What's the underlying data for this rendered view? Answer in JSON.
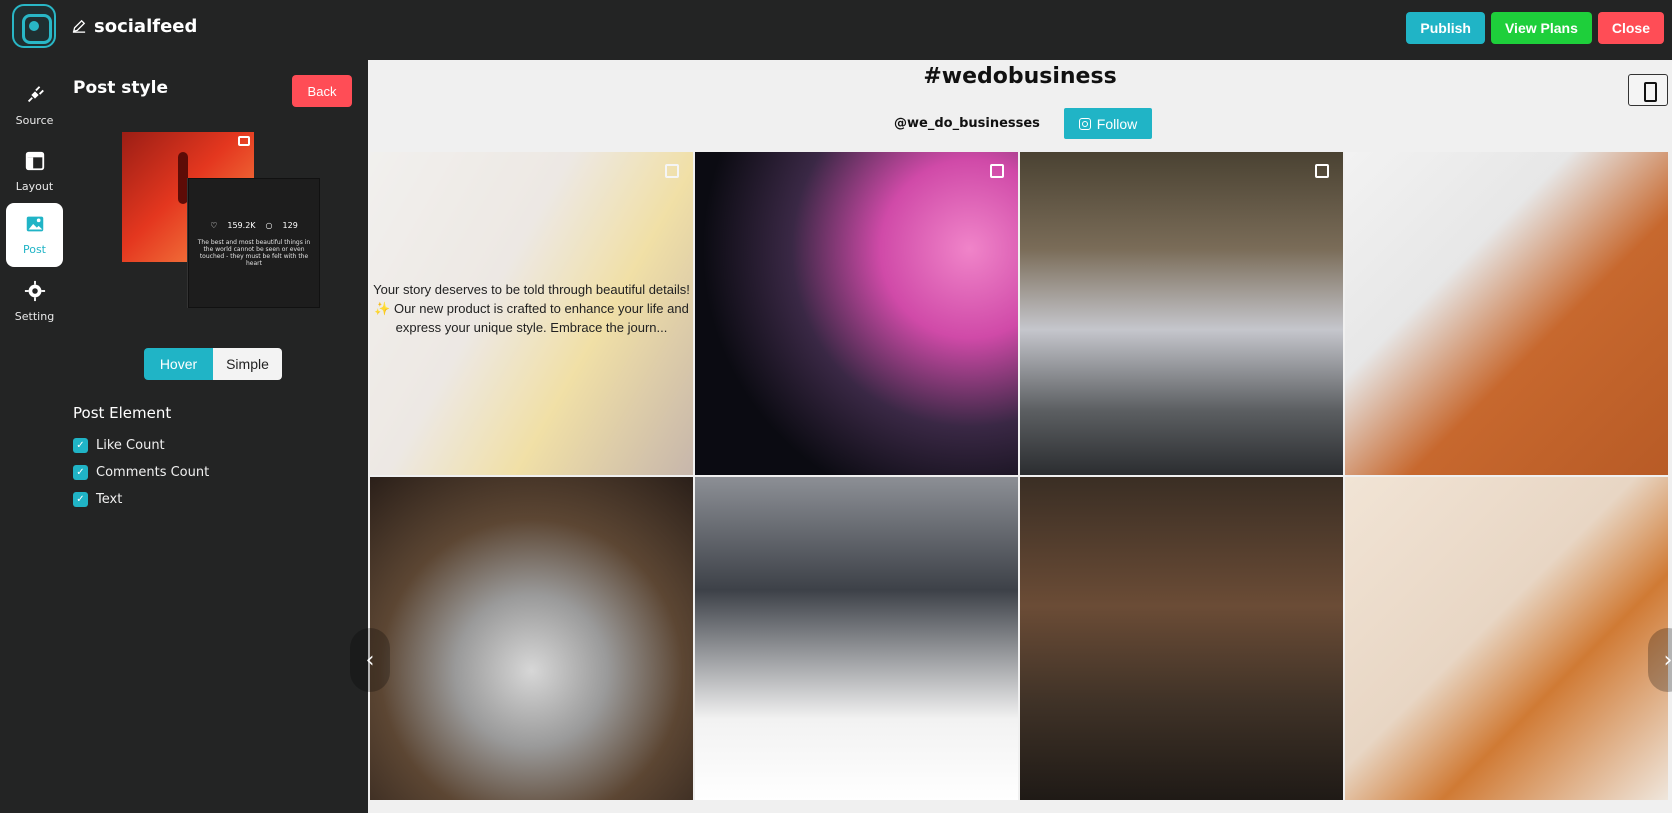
{
  "app": {
    "title": "socialfeed"
  },
  "toolbar": {
    "publish_label": "Publish",
    "view_plans_label": "View Plans",
    "close_label": "Close"
  },
  "leftnav": {
    "items": [
      {
        "label": "Source",
        "icon": "plug-icon"
      },
      {
        "label": "Layout",
        "icon": "layout-icon"
      },
      {
        "label": "Post",
        "icon": "image-icon",
        "active": true
      },
      {
        "label": "Setting",
        "icon": "gear-icon"
      }
    ]
  },
  "panel": {
    "title": "Post style",
    "back_label": "Back",
    "preview": {
      "likes": "159.2K",
      "comments": "129",
      "text": "The best and most beautiful things in the world cannot be seen or even touched - they must be felt with the heart"
    },
    "toggle": {
      "hover_label": "Hover",
      "simple_label": "Simple",
      "selected": "Hover"
    },
    "post_element_title": "Post Element",
    "elements": [
      {
        "label": "Like Count",
        "checked": true
      },
      {
        "label": "Comments Count",
        "checked": true
      },
      {
        "label": "Text",
        "checked": true
      }
    ]
  },
  "feed": {
    "hashtag": "#wedobusiness",
    "account": "@we_do_businesses",
    "follow_label": "Follow",
    "overlay_text": "Your story deserves to be told through beautiful details! ✨ Our new product is crafted to enhance your life and express your unique style. Embrace the journ..."
  }
}
